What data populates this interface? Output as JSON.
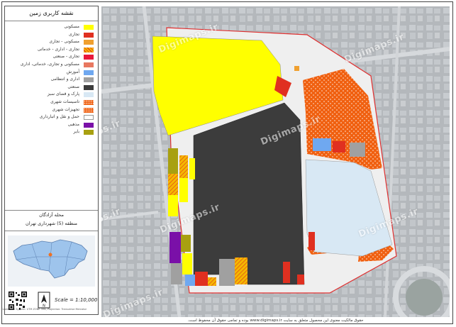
{
  "legend": {
    "title": "نقشه کاربری زمین",
    "items": [
      {
        "label": "مسکونی",
        "color": "#ffff00",
        "pattern": "solid"
      },
      {
        "label": "تجاری",
        "color": "#e03020",
        "pattern": "solid"
      },
      {
        "label": "مسکونی - تجاری",
        "color": "#f0a030",
        "pattern": "solid"
      },
      {
        "label": "تجاری - اداری - خدماتی",
        "color": "#f5b800",
        "pattern": "hatch"
      },
      {
        "label": "تجاری - صنعتی",
        "color": "#e8183c",
        "pattern": "solid"
      },
      {
        "label": "مسکونی و تجاری، خدماتی، اداری",
        "color": "#e87860",
        "pattern": "solid"
      },
      {
        "label": "آموزش",
        "color": "#6fa8f0",
        "pattern": "solid"
      },
      {
        "label": "اداری و انتظامی",
        "color": "#a0a0a0",
        "pattern": "solid"
      },
      {
        "label": "صنعتی",
        "color": "#3c3c3c",
        "pattern": "solid"
      },
      {
        "label": "پارک و فضای سبز",
        "color": "#d8e8f4",
        "pattern": "solid"
      },
      {
        "label": "تاسیسات شهری",
        "color": "#f06010",
        "pattern": "dots"
      },
      {
        "label": "تجهیزات شهری",
        "color": "#f06010",
        "pattern": "dots2"
      },
      {
        "label": "حمل و نقل و انبارداری",
        "color": "#ffffff",
        "pattern": "solid"
      },
      {
        "label": "مذهبی",
        "color": "#7a10a8",
        "pattern": "solid"
      },
      {
        "label": "بایر",
        "color": "#a8a010",
        "pattern": "solid"
      }
    ]
  },
  "area": {
    "name": "محله آزادگان",
    "district": "منطقه (5) شهرداری تهران"
  },
  "scale": "Scale = 1:10,000",
  "credits": "Coordinate System: UTM ZONE 39N, Projection: Transverse Mercator",
  "watermark": "Digimaps.ir",
  "footer_note": "حقوق مالکیت معنوی این محصول متعلق به سایت www.digimaps.ir بوده و تمامی حقوق آن محفوظ است.",
  "colors": {
    "residential": "#ffff00",
    "industrial": "#3c3c3c",
    "park": "#d8e8f4",
    "urban_facilities": "#f06010",
    "boundary": "#e03030"
  }
}
